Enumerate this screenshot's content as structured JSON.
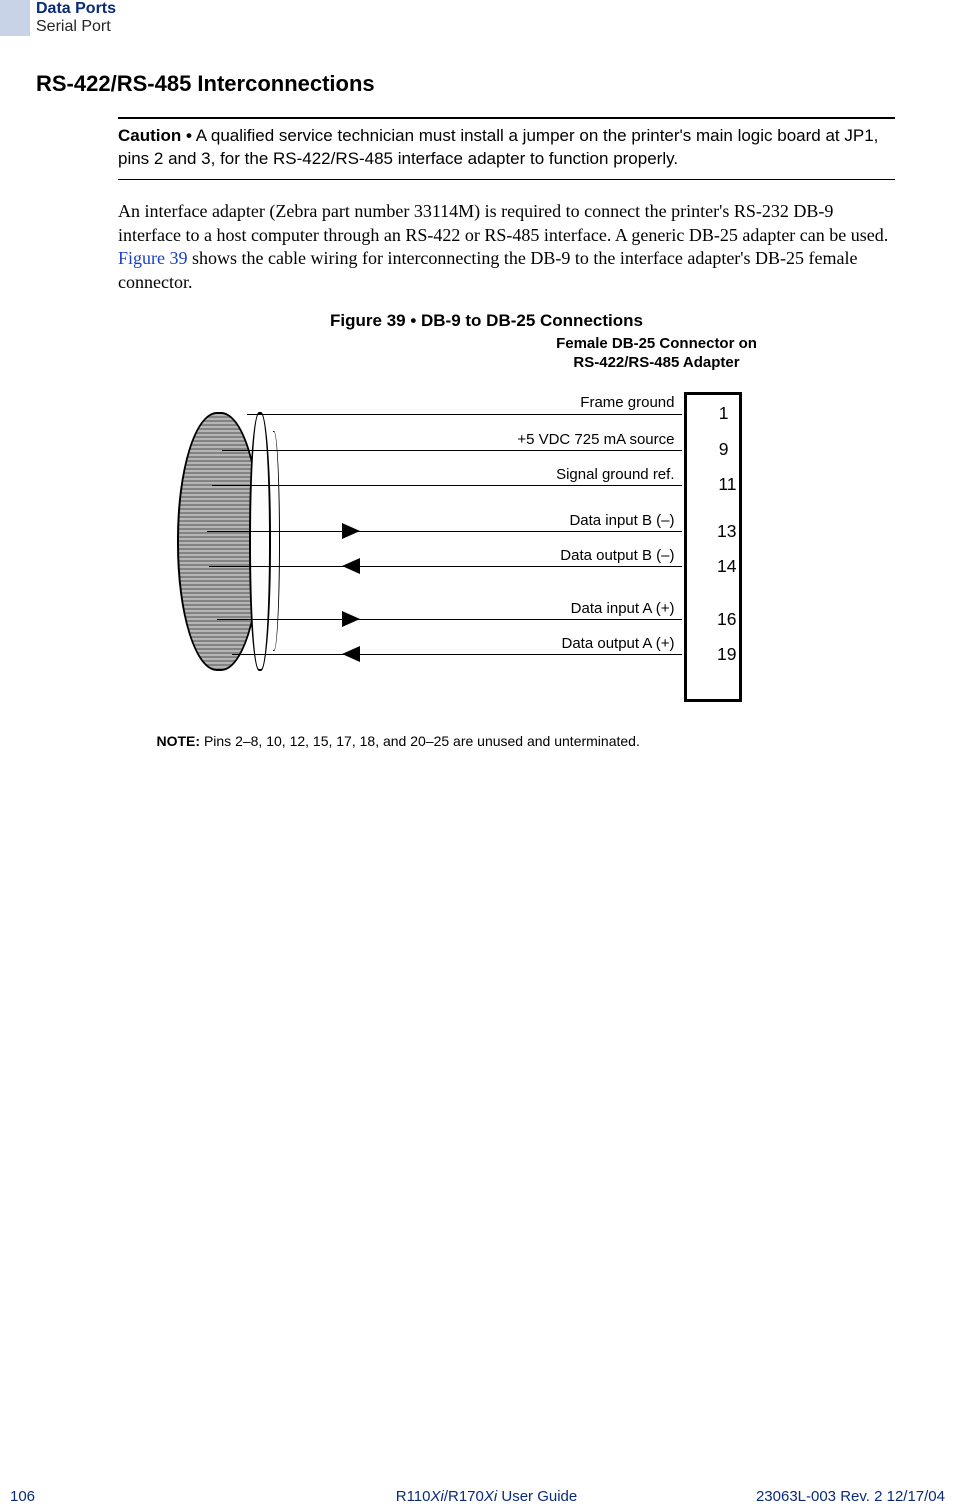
{
  "header": {
    "title": "Data Ports",
    "subtitle": "Serial Port"
  },
  "section_heading": "RS-422/RS-485 Interconnections",
  "caution": {
    "label": "Caution •",
    "text": " A qualified service technician must install a jumper on the printer's main logic board at JP1, pins 2 and 3, for the RS-422/RS-485 interface adapter to function properly."
  },
  "paragraph": {
    "before_link": "An interface adapter (Zebra part number 33114M) is required to connect the printer's RS-232 DB-9 interface to a host computer through an RS-422 or RS-485 interface. A generic DB-25 adapter can be used. ",
    "link_text": "Figure 39",
    "after_link": " shows the cable wiring for interconnecting the DB-9 to the interface adapter's DB-25 female connector."
  },
  "figure": {
    "caption": "Figure 39 • DB-9 to DB-25 Connections",
    "connector_title_line1": "Female DB-25 Connector on",
    "connector_title_line2": "RS-422/RS-485 Adapter",
    "pins": {
      "p1": "1",
      "p9": "9",
      "p11": "11",
      "p13": "13",
      "p14": "14",
      "p16": "16",
      "p19": "19"
    },
    "labels": {
      "w1": "Frame ground",
      "w2": "+5 VDC 725 mA source",
      "w3": "Signal ground ref.",
      "w4": "Data input B (–)",
      "w5": "Data output B (–)",
      "w6": "Data input A (+)",
      "w7": "Data output A (+)"
    },
    "note_label": "NOTE:",
    "note_text": "  Pins 2–8, 10, 12, 15, 17, 18, and 20–25 are unused and unterminated."
  },
  "footer": {
    "page": "106",
    "guide_prefix": "R110",
    "guide_italic1": "Xi",
    "guide_mid": "/R170",
    "guide_italic2": "Xi",
    "guide_suffix": " User Guide",
    "rev": "23063L-003 Rev. 2    12/17/04"
  }
}
